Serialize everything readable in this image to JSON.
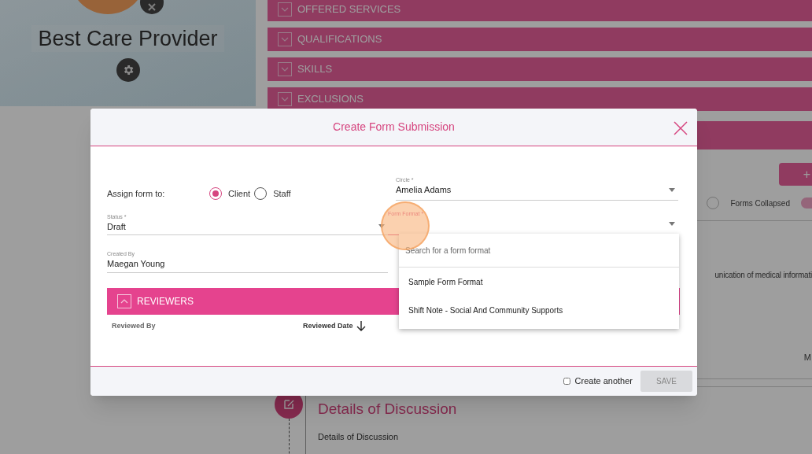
{
  "profile": {
    "name": "Best Care Provider"
  },
  "sections": [
    {
      "label": "OFFERED SERVICES"
    },
    {
      "label": "QUALIFICATIONS"
    },
    {
      "label": "SKILLS"
    },
    {
      "label": "EXCLUSIONS"
    }
  ],
  "add_button": {
    "label": "+"
  },
  "view_radio": {
    "selected": false
  },
  "forms_collapsed": {
    "label": "Forms Collapsed",
    "on": true
  },
  "note_fragment": "unication of medical informati",
  "column_fragment": "M",
  "details": {
    "title": "Details of Discussion",
    "body": "Details of Discussion"
  },
  "dialog": {
    "title": "Create Form Submission",
    "assign_label": "Assign form to:",
    "assign_options": [
      {
        "label": "Client",
        "selected": true
      },
      {
        "label": "Staff",
        "selected": false
      }
    ],
    "circle": {
      "label": "Circle *",
      "value": "Amelia Adams"
    },
    "status": {
      "label": "Status *",
      "value": "Draft"
    },
    "form_format": {
      "label": "Form Format *",
      "open": true
    },
    "created_by": {
      "label": "Created By",
      "value": "Maegan Young"
    },
    "reviewers": {
      "title": "REVIEWERS",
      "expanded": true
    },
    "columns": [
      {
        "label": "Reviewed By",
        "sorted": false
      },
      {
        "label": "Reviewed Date",
        "sorted": true
      }
    ],
    "dropdown": {
      "placeholder": "Search for a form format",
      "options": [
        {
          "label": "Sample Form Format"
        },
        {
          "label": "Shift Note - Social And Community Supports"
        }
      ]
    },
    "create_another": {
      "label": "Create another",
      "checked": false
    },
    "save": {
      "label": "SAVE",
      "disabled": true
    }
  }
}
